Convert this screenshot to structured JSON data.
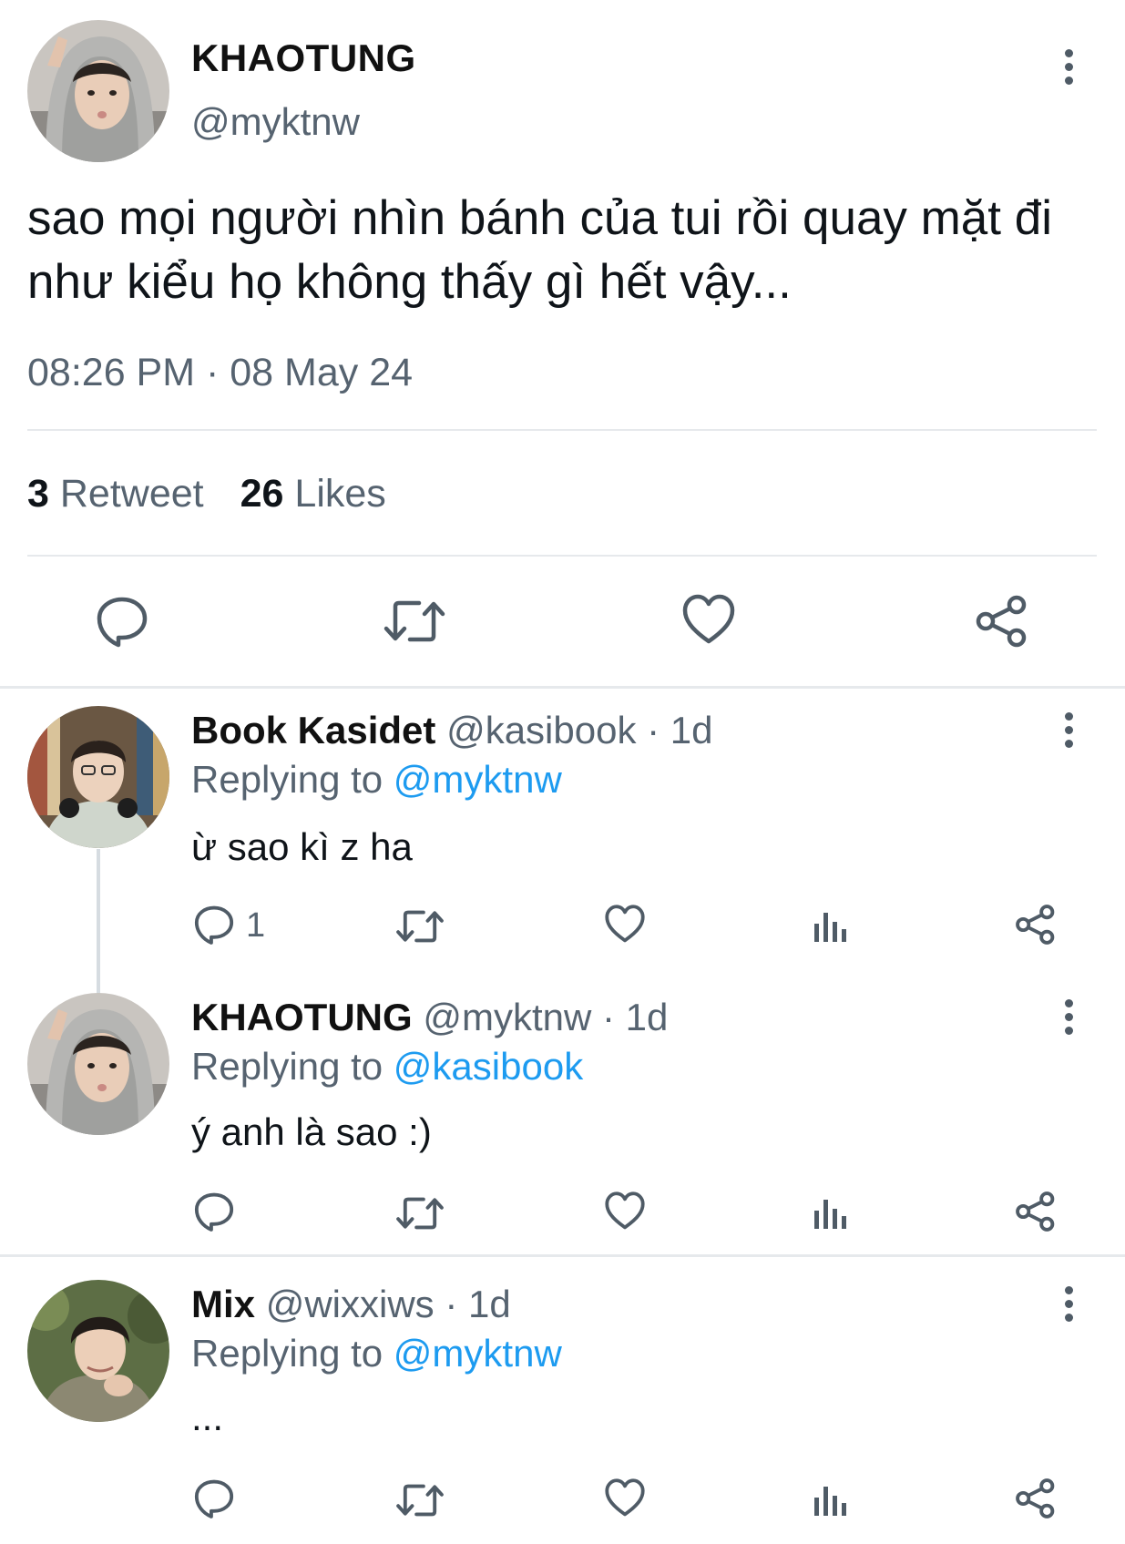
{
  "main_tweet": {
    "display_name": "KHAOTUNG",
    "handle": "@myktnw",
    "text": "sao mọi người nhìn bánh của tui rồi quay mặt đi như kiểu họ không thấy gì hết vậy...",
    "timestamp": "08:26 PM · 08 May 24",
    "retweet_count": "3",
    "retweet_label": "Retweet",
    "likes_count": "26",
    "likes_label": "Likes",
    "actions": [
      "reply-icon",
      "retweet-icon",
      "like-icon",
      "share-icon"
    ]
  },
  "replies": [
    {
      "display_name": "Book Kasidet",
      "handle": "@kasibook",
      "sep": " · ",
      "age": "1d",
      "replying_prefix": "Replying to ",
      "replying_to": "@myktnw",
      "text": "ừ sao kì z ha",
      "reply_count": "1"
    },
    {
      "display_name": "KHAOTUNG",
      "handle": "@myktnw",
      "sep": " · ",
      "age": "1d",
      "replying_prefix": "Replying to ",
      "replying_to": "@kasibook",
      "text": "ý anh là sao :)",
      "reply_count": ""
    },
    {
      "display_name": "Mix",
      "handle": "@wixxiws",
      "sep": " · ",
      "age": "1d",
      "replying_prefix": "Replying to ",
      "replying_to": "@myktnw",
      "text": "...",
      "reply_count": ""
    }
  ],
  "colors": {
    "text": "#0f1419",
    "secondary": "#566370",
    "link": "#1d9bf0",
    "divider": "#e6e9ec"
  }
}
